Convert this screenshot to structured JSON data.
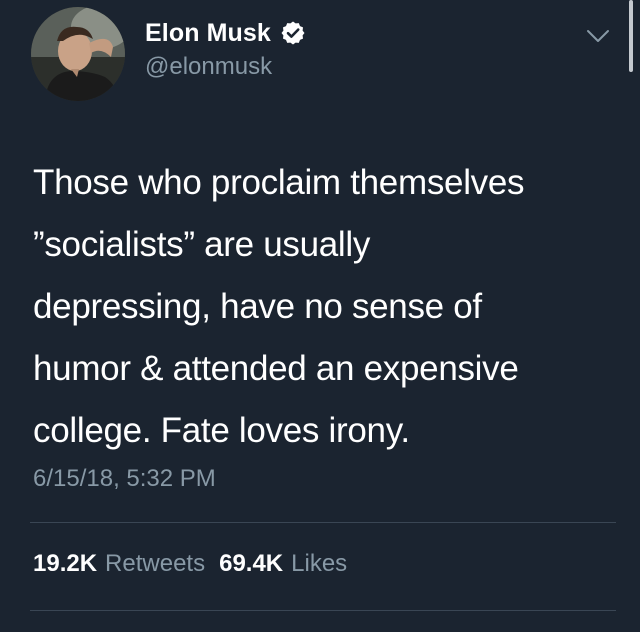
{
  "author": {
    "display_name": "Elon Musk",
    "handle": "@elonmusk",
    "verified": true
  },
  "tweet": {
    "text": "Those who proclaim themselves\n”socialists” are usually\ndepressing, have no sense of\nhumor & attended an expensive\ncollege. Fate loves irony.",
    "timestamp": "6/15/18, 5:32 PM"
  },
  "stats": {
    "retweets_count": "19.2K",
    "retweets_label": "Retweets",
    "likes_count": "69.4K",
    "likes_label": "Likes"
  },
  "icons": {
    "verified": "verified-badge-icon",
    "menu": "chevron-down-icon"
  },
  "colors": {
    "background": "#1b2430",
    "secondary_text": "#8899a6",
    "verified_badge": "#ffffff"
  }
}
